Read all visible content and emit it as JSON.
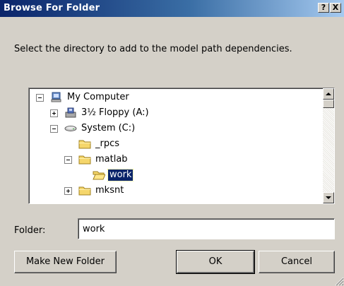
{
  "window": {
    "title": "Browse For Folder",
    "help_glyph": "?",
    "close_glyph": "X"
  },
  "instruction": "Select the directory to add to the model path dependencies.",
  "tree": {
    "items": [
      {
        "label": "My Computer",
        "icon": "computer-icon",
        "expander": "minus"
      },
      {
        "label": "3½ Floppy (A:)",
        "icon": "floppy-drive-icon",
        "expander": "plus"
      },
      {
        "label": "System (C:)",
        "icon": "hard-drive-icon",
        "expander": "minus"
      },
      {
        "label": "_rpcs",
        "icon": "folder-icon",
        "expander": "none"
      },
      {
        "label": "matlab",
        "icon": "folder-icon",
        "expander": "minus"
      },
      {
        "label": "work",
        "icon": "open-folder-icon",
        "expander": "none",
        "selected": true
      },
      {
        "label": "mksnt",
        "icon": "folder-icon",
        "expander": "plus"
      }
    ]
  },
  "folder_field": {
    "label": "Folder:",
    "value": "work"
  },
  "buttons": {
    "make_new_folder": "Make New Folder",
    "ok": "OK",
    "cancel": "Cancel"
  },
  "colors": {
    "titlebar_start": "#0a246a",
    "titlebar_end": "#a6caf0",
    "dialog_face": "#d4d0c8",
    "selection": "#0a246a",
    "folder_yellow": "#f5d66b"
  }
}
